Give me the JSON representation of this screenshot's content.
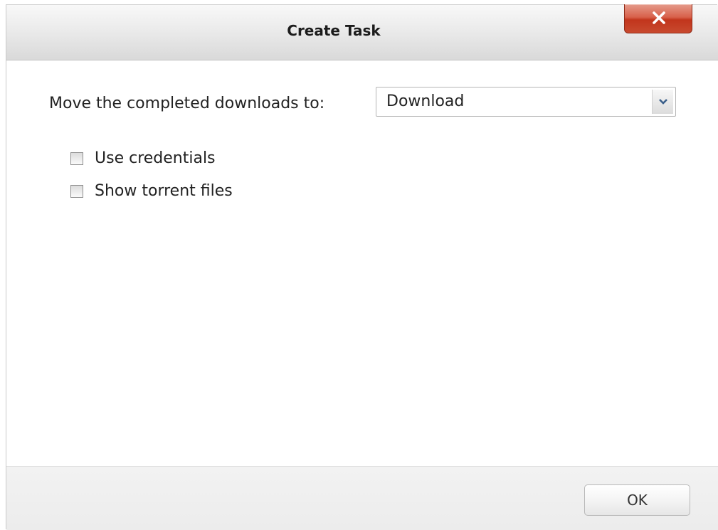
{
  "dialog": {
    "title": "Create Task",
    "close_label": "x"
  },
  "form": {
    "move_label": "Move the completed downloads to:",
    "destination": {
      "selected": "Download"
    },
    "options": [
      {
        "label": "Use credentials",
        "checked": false
      },
      {
        "label": "Show torrent files",
        "checked": false
      }
    ]
  },
  "footer": {
    "ok_label": "OK"
  },
  "colors": {
    "close_button": "#c84a2f",
    "titlebar": "#e6e6e6",
    "footer": "#eeeeee"
  },
  "icons": {
    "close": "close-icon",
    "dropdown": "chevron-down-icon"
  }
}
